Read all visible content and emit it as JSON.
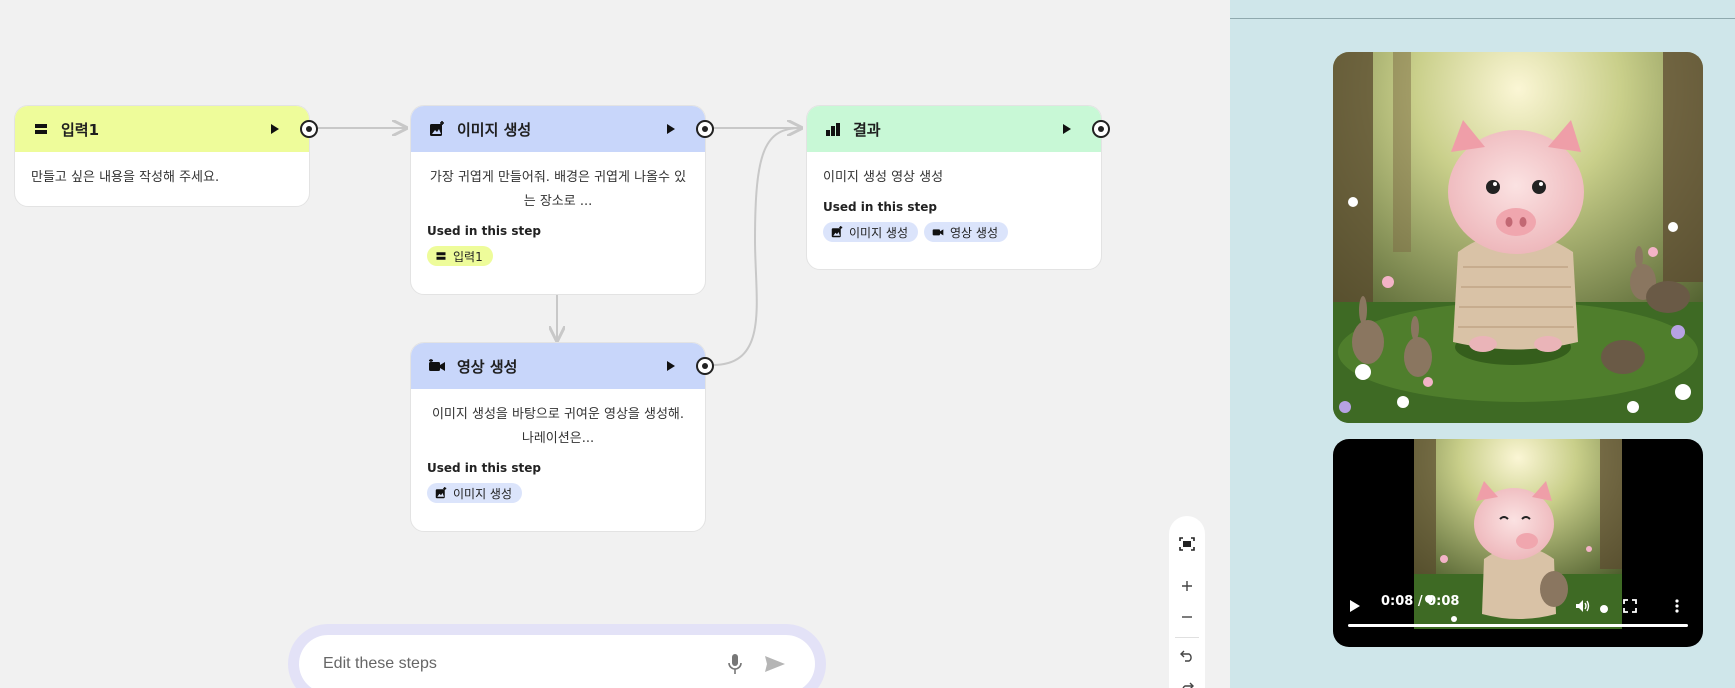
{
  "nodes": {
    "input1": {
      "title": "입력1",
      "description": "만들고 싶은 내용을 작성해 주세요."
    },
    "image_gen": {
      "title": "이미지 생성",
      "description": "가장 귀엽게 만들어줘. 배경은 귀엽게 나올수 있는 장소로 ...",
      "used_label": "Used in this step",
      "chips": [
        "입력1"
      ]
    },
    "video_gen": {
      "title": "영상 생성",
      "description": "이미지 생성을 바탕으로 귀여운 영상을 생성해. 나레이션은...",
      "used_label": "Used in this step",
      "chips": [
        "이미지 생성"
      ]
    },
    "result": {
      "title": "결과",
      "description": "이미지 생성 영상 생성",
      "used_label": "Used in this step",
      "chips": [
        "이미지 생성",
        "영상 생성"
      ]
    }
  },
  "chat": {
    "placeholder": "Edit these steps"
  },
  "video": {
    "time": "0:08 / 0:08",
    "progress": 1.0
  },
  "colors": {
    "yellow_header": "#eefc9a",
    "blue_header": "#c8d6fa",
    "green_header": "#c8f8d6",
    "panel_bg": "#cfe6ea",
    "canvas_bg": "#f1f1f1"
  },
  "icons": {
    "input": "text-input-icon",
    "image": "image-generate-icon",
    "video": "video-generate-icon",
    "result": "chart-result-icon"
  }
}
